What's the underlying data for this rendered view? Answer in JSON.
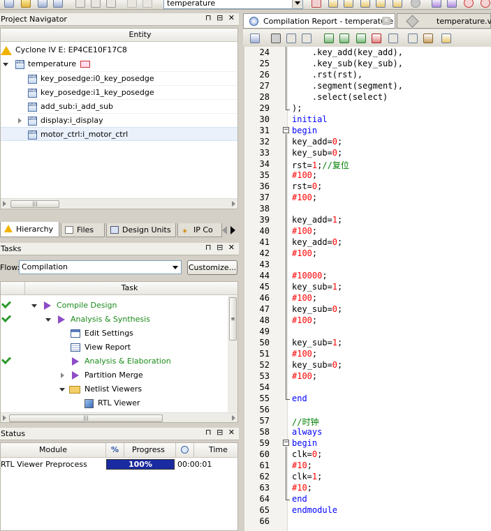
{
  "toolbar": {
    "project_combo": "temperature"
  },
  "project_navigator": {
    "title": "Project Navigator",
    "column": "Entity",
    "device": "Cyclone IV E: EP4CE10F17C8",
    "top": "temperature",
    "children": [
      "key_posedge:i0_key_posedge",
      "key_posedge:i1_key_posedge",
      "add_sub:i_add_sub",
      "display:i_display",
      "motor_ctrl:i_motor_ctrl"
    ],
    "tabs": [
      "Hierarchy",
      "Files",
      "Design Units",
      "IP Co"
    ]
  },
  "tasks": {
    "title": "Tasks",
    "flow_label": "Flow:",
    "flow_value": "Compilation",
    "customize": "Customize...",
    "column": "Task",
    "items": [
      "Compile Design",
      "Analysis & Synthesis",
      "Edit Settings",
      "View Report",
      "Analysis & Elaboration",
      "Partition Merge",
      "Netlist Viewers",
      "RTL Viewer"
    ]
  },
  "status": {
    "title": "Status",
    "col_module": "Module",
    "col_pct": "%",
    "col_progress": "Progress",
    "col_time": "Time",
    "row_module": "RTL Viewer Preprocess",
    "row_progress": "100%",
    "progress_value": 1.0,
    "row_time": "00:00:01"
  },
  "editor": {
    "tab1": "Compilation Report - temperature",
    "tab2": "temperature.v",
    "lines": [
      {
        "n": "24",
        "t": "    .key_add(key_add),"
      },
      {
        "n": "25",
        "t": "    .key_sub(key_sub),"
      },
      {
        "n": "26",
        "t": "    .rst(rst),"
      },
      {
        "n": "27",
        "t": "    .segment(segment),"
      },
      {
        "n": "28",
        "t": "    .select(select)"
      },
      {
        "n": "29",
        "t": ");"
      },
      {
        "n": "30",
        "t": "initial"
      },
      {
        "n": "31",
        "t": "begin"
      },
      {
        "n": "32",
        "t": "key_add=0;"
      },
      {
        "n": "33",
        "t": "key_sub=0;"
      },
      {
        "n": "34",
        "t": "rst=1;//复位"
      },
      {
        "n": "35",
        "t": "#100;"
      },
      {
        "n": "36",
        "t": "rst=0;"
      },
      {
        "n": "37",
        "t": "#100;"
      },
      {
        "n": "38",
        "t": ""
      },
      {
        "n": "39",
        "t": "key_add=1;"
      },
      {
        "n": "40",
        "t": "#100;"
      },
      {
        "n": "41",
        "t": "key_add=0;"
      },
      {
        "n": "42",
        "t": "#100;"
      },
      {
        "n": "43",
        "t": ""
      },
      {
        "n": "44",
        "t": "#10000;"
      },
      {
        "n": "45",
        "t": "key_sub=1;"
      },
      {
        "n": "46",
        "t": "#100;"
      },
      {
        "n": "47",
        "t": "key_sub=0;"
      },
      {
        "n": "48",
        "t": "#100;"
      },
      {
        "n": "49",
        "t": ""
      },
      {
        "n": "50",
        "t": "key_sub=1;"
      },
      {
        "n": "51",
        "t": "#100;"
      },
      {
        "n": "52",
        "t": "key_sub=0;"
      },
      {
        "n": "53",
        "t": "#100;"
      },
      {
        "n": "54",
        "t": ""
      },
      {
        "n": "55",
        "t": "end"
      },
      {
        "n": "56",
        "t": ""
      },
      {
        "n": "57",
        "t": "//时钟"
      },
      {
        "n": "58",
        "t": "always"
      },
      {
        "n": "59",
        "t": "begin"
      },
      {
        "n": "60",
        "t": "clk=0;"
      },
      {
        "n": "61",
        "t": "#10;"
      },
      {
        "n": "62",
        "t": "clk=1;"
      },
      {
        "n": "63",
        "t": "#10;"
      },
      {
        "n": "64",
        "t": "end"
      },
      {
        "n": "65",
        "t": "endmodule"
      },
      {
        "n": "66",
        "t": ""
      }
    ]
  }
}
